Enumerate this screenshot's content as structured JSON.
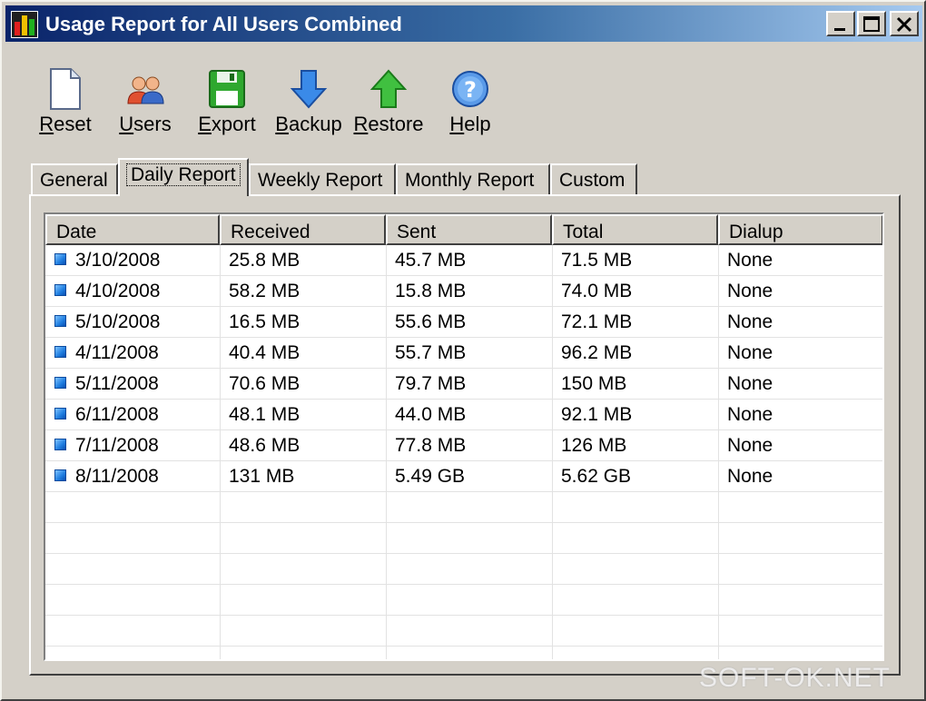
{
  "window": {
    "title": "Usage Report for All Users Combined"
  },
  "toolbar": [
    {
      "label": "Reset",
      "key": "R",
      "rest": "eset",
      "icon": "document-icon"
    },
    {
      "label": "Users",
      "key": "U",
      "rest": "sers",
      "icon": "users-icon"
    },
    {
      "label": "Export",
      "key": "E",
      "rest": "xport",
      "icon": "floppy-disk-icon"
    },
    {
      "label": "Backup",
      "key": "B",
      "rest": "ackup",
      "icon": "arrow-down-icon"
    },
    {
      "label": "Restore",
      "key": "R",
      "rest": "estore",
      "icon": "arrow-up-icon"
    },
    {
      "label": "Help",
      "key": "H",
      "rest": "elp",
      "icon": "help-icon"
    }
  ],
  "tabs": [
    "General",
    "Daily Report",
    "Weekly Report",
    "Monthly Report",
    "Custom"
  ],
  "active_tab": "Daily Report",
  "table": {
    "columns": [
      "Date",
      "Received",
      "Sent",
      "Total",
      "Dialup"
    ],
    "rows": [
      [
        "3/10/2008",
        "25.8 MB",
        "45.7 MB",
        "71.5 MB",
        "None"
      ],
      [
        "4/10/2008",
        "58.2 MB",
        "15.8 MB",
        "74.0 MB",
        "None"
      ],
      [
        "5/10/2008",
        "16.5 MB",
        "55.6 MB",
        "72.1 MB",
        "None"
      ],
      [
        "4/11/2008",
        "40.4 MB",
        "55.7 MB",
        "96.2 MB",
        "None"
      ],
      [
        "5/11/2008",
        "70.6 MB",
        "79.7 MB",
        "150 MB",
        "None"
      ],
      [
        "6/11/2008",
        "48.1 MB",
        "44.0 MB",
        "92.1 MB",
        "None"
      ],
      [
        "7/11/2008",
        "48.6 MB",
        "77.8 MB",
        "126 MB",
        "None"
      ],
      [
        "8/11/2008",
        "131 MB",
        "5.49 GB",
        "5.62 GB",
        "None"
      ]
    ]
  },
  "watermark": "SOFT-OK.NET",
  "colors": {
    "titlebar_start": "#0a246a",
    "titlebar_end": "#a6caf0",
    "face": "#d4d0c8"
  }
}
